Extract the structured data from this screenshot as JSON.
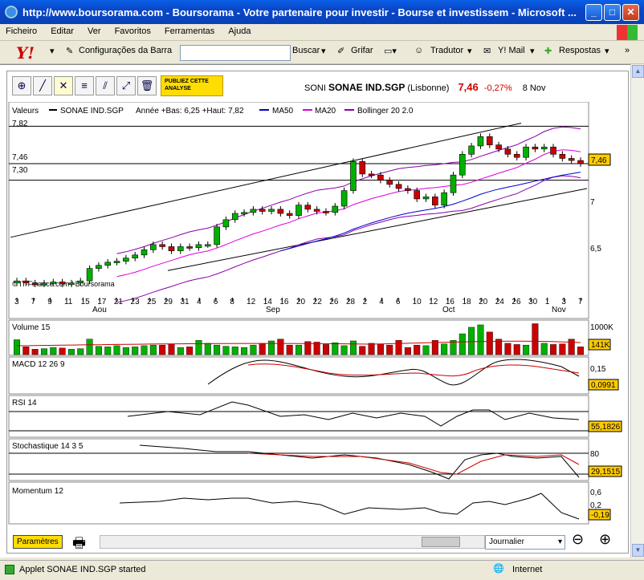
{
  "window": {
    "title": "http://www.boursorama.com - Boursorama - Votre partenaire pour investir - Bourse et investissem - Microsoft ..."
  },
  "menu": [
    "Ficheiro",
    "Editar",
    "Ver",
    "Favoritos",
    "Ferramentas",
    "Ajuda"
  ],
  "toolbar": {
    "config_label": "Configurações da Barra",
    "search_label": "Buscar",
    "grifar_label": "Grifar",
    "tradutor_label": "Tradutor",
    "mail_label": "Y! Mail",
    "respostas_label": "Respostas"
  },
  "applet": {
    "pub_label": "PUBLIEZ CETTE ANALYSE",
    "symbol": "SONI",
    "name": "SONAE IND.SGP",
    "market": "(Lisbonne)",
    "price": "7,46",
    "change": "-0,27%",
    "date": "8 Nov"
  },
  "legend": {
    "valeurs": "Valeurs",
    "series_name": "SONAE IND.SGP",
    "range_info": "Année +Bas: 6,25 +Haut: 7,82",
    "ma50": "MA50",
    "ma20": "MA20",
    "bollinger": "Bollinger 20 2.0",
    "credit": "© IT-Finance.com / Boursorama"
  },
  "colors": {
    "ma50": "#0000cc",
    "ma20": "#dd00dd",
    "bollinger": "#8800aa",
    "up": "#00b000",
    "down": "#cc0000",
    "badge": "#ffcc00"
  },
  "chart_data": {
    "type": "candlestick",
    "ylim": [
      6.2,
      7.9
    ],
    "price_levels": {
      "high_line": "7,82",
      "mid_line": "7,46",
      "low_line": "7,30"
    },
    "y_ticks": [
      "7",
      "6,5"
    ],
    "current_badge": "7,46",
    "x_ticks": [
      "3",
      "7",
      "9",
      "11",
      "15",
      "17",
      "21",
      "23",
      "25",
      "29",
      "31",
      "4",
      "6",
      "8",
      "12",
      "14",
      "16",
      "20",
      "22",
      "26",
      "28",
      "2",
      "4",
      "6",
      "10",
      "12",
      "16",
      "18",
      "20",
      "24",
      "26",
      "30",
      "1",
      "3",
      "7"
    ],
    "months": [
      "Aou",
      "Sep",
      "Oct",
      "Nov"
    ],
    "closes": [
      6.33,
      6.31,
      6.3,
      6.31,
      6.32,
      6.3,
      6.31,
      6.33,
      6.45,
      6.48,
      6.51,
      6.52,
      6.55,
      6.58,
      6.63,
      6.68,
      6.66,
      6.62,
      6.66,
      6.65,
      6.68,
      6.68,
      6.85,
      6.92,
      6.98,
      6.99,
      7.02,
      7.0,
      7.02,
      6.98,
      6.96,
      7.06,
      7.02,
      7.0,
      6.99,
      7.05,
      7.2,
      7.48,
      7.36,
      7.35,
      7.3,
      7.26,
      7.22,
      7.2,
      7.12,
      7.14,
      7.06,
      7.18,
      7.35,
      7.55,
      7.63,
      7.72,
      7.64,
      7.6,
      7.55,
      7.52,
      7.62,
      7.6,
      7.62,
      7.55,
      7.51,
      7.49,
      7.46
    ]
  },
  "volume": {
    "label": "Volume 15",
    "axis_top": "1000K",
    "badge": "141K",
    "values": [
      2.5,
      1.3,
      0.9,
      1.0,
      1.2,
      1.1,
      0.9,
      1.0,
      2.6,
      1.4,
      1.3,
      1.5,
      1.2,
      1.3,
      1.5,
      1.6,
      1.6,
      1.8,
      1.2,
      1.3,
      2.4,
      1.9,
      1.6,
      1.4,
      1.3,
      1.2,
      1.6,
      1.8,
      2.3,
      2.6,
      1.6,
      1.6,
      2.2,
      2.1,
      1.7,
      2.0,
      1.5,
      2.3,
      1.4,
      1.9,
      1.8,
      1.6,
      2.4,
      1.2,
      1.6,
      1.5,
      2.4,
      1.8,
      2.4,
      3.5,
      4.6,
      5.0,
      3.8,
      2.6,
      1.9,
      1.7,
      1.6,
      5.2,
      1.9,
      1.7,
      1.8,
      2.6,
      1.3
    ]
  },
  "macd": {
    "label": "MACD 12 26 9",
    "axis_top": "0,15",
    "badge": "0,0991"
  },
  "rsi": {
    "label": "RSI 14",
    "badge": "55,1826"
  },
  "stoch": {
    "label": "Stochastique 14 3 5",
    "axis_top": "80",
    "badge": "29,1515"
  },
  "momentum": {
    "label": "Momentum 12",
    "axis_top": "0,6",
    "axis_mid": "0,2",
    "badge": "-0,19"
  },
  "bottom": {
    "param_label": "Paramètres",
    "period_select": "Journalier"
  },
  "status": {
    "text": "Applet SONAE IND.SGP started",
    "zone": "Internet"
  }
}
